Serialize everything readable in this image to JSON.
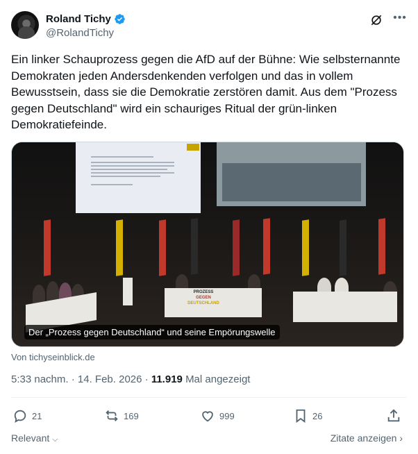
{
  "author": {
    "display_name": "Roland Tichy",
    "handle": "@RolandTichy",
    "verified": true
  },
  "tweet": {
    "text": "Ein linker Schauprozess gegen die AfD auf der Bühne: Wie selbsternannte Demokraten jeden Andersdenkenden verfolgen und das in vollem Bewusstsein, dass sie die Demokratie zerstören damit. Aus dem \"Prozess gegen Deutschland\" wird ein schauriges Ritual der grün-linken Demokratiefeinde."
  },
  "media": {
    "caption": "Der „Prozess gegen Deutschland“ und seine Empörungswelle",
    "podium_lines": [
      "PROZESS",
      "GEGEN",
      "DEUTSCHLAND"
    ]
  },
  "source": "Von tichyseinblick.de",
  "meta": {
    "time": "5:33 nachm.",
    "date": "14. Feb. 2026",
    "views": "11.919",
    "views_label": "Mal angezeigt"
  },
  "actions": {
    "replies": "21",
    "reposts": "169",
    "likes": "999",
    "bookmarks": "26"
  },
  "footer": {
    "sort_label": "Relevant",
    "quotes_label": "Zitate anzeigen"
  },
  "colors": {
    "accent": "#1d9bf0",
    "secondary_text": "#536471",
    "primary_text": "#0f1419"
  },
  "icons": [
    "verified-badge-icon",
    "grok-icon",
    "more-icon",
    "reply-icon",
    "repost-icon",
    "like-icon",
    "bookmark-icon",
    "share-icon",
    "chevron-down-icon",
    "chevron-right-icon"
  ]
}
